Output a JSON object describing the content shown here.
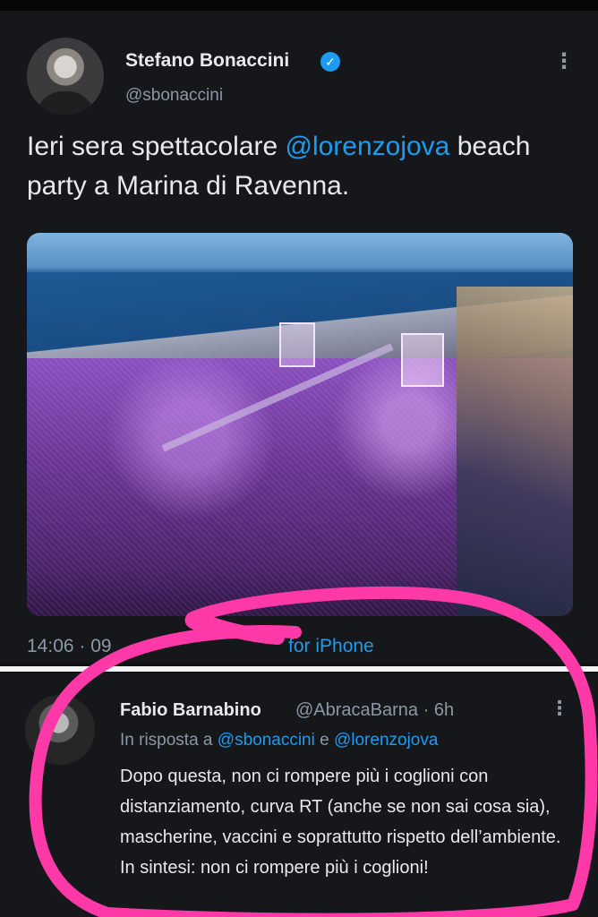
{
  "tweet": {
    "author_name": "Stefano Bonaccini",
    "author_handle": "@sbonaccini",
    "verified_icon": "verified-badge-icon",
    "text_before": "Ieri sera spettacolare ",
    "mention": "@lorenzojova",
    "text_after": " beach party a Marina di Ravenna.",
    "time": "14:06 · 09",
    "source": "for iPhone"
  },
  "reply": {
    "author_name": "Fabio Barnabino",
    "author_handle": "@AbracaBarna · 6h",
    "reply_prefix": "In risposta a ",
    "reply_mention_1": "@sbonaccini",
    "reply_joiner": " e ",
    "reply_mention_2": "@lorenzojova",
    "text": "Dopo questa, non ci rompere più i coglioni con distanziamento, curva RT (anche se non sai cosa sia), mascherine, vaccini e soprattutto rispetto dell’ambiente. In sintesi: non ci rompere più i coglioni!"
  },
  "colors": {
    "background": "#15171b",
    "link": "#1d9bf0",
    "secondary_text": "#8b98a5",
    "marker": "#ff3aa8"
  }
}
